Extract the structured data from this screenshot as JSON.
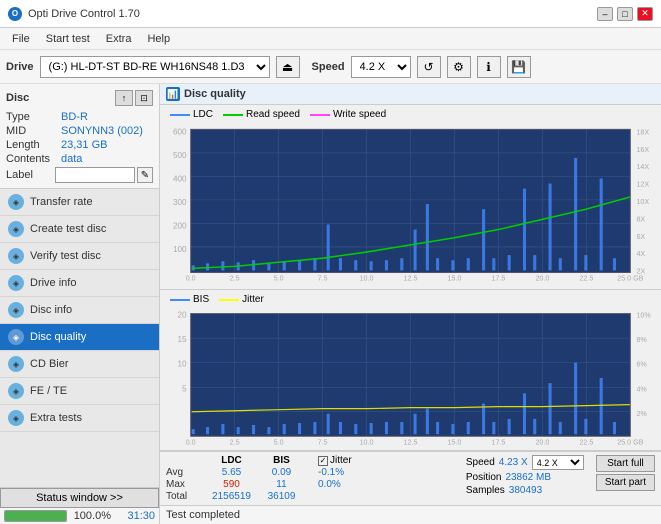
{
  "titlebar": {
    "title": "Opti Drive Control 1.70",
    "logo": "O",
    "min_btn": "–",
    "max_btn": "□",
    "close_btn": "✕"
  },
  "menubar": {
    "items": [
      "File",
      "Start test",
      "Extra",
      "Help"
    ]
  },
  "toolbar": {
    "drive_label": "Drive",
    "drive_value": "(G:) HL-DT-ST BD-RE  WH16NS48 1.D3",
    "speed_label": "Speed",
    "speed_value": "4.2 X"
  },
  "disc_panel": {
    "title": "Disc",
    "type_label": "Type",
    "type_value": "BD-R",
    "mid_label": "MID",
    "mid_value": "SONYNN3 (002)",
    "length_label": "Length",
    "length_value": "23,31 GB",
    "contents_label": "Contents",
    "contents_value": "data",
    "label_label": "Label",
    "label_value": ""
  },
  "nav_items": [
    {
      "id": "transfer-rate",
      "label": "Transfer rate",
      "active": false
    },
    {
      "id": "create-test-disc",
      "label": "Create test disc",
      "active": false
    },
    {
      "id": "verify-test-disc",
      "label": "Verify test disc",
      "active": false
    },
    {
      "id": "drive-info",
      "label": "Drive info",
      "active": false
    },
    {
      "id": "disc-info",
      "label": "Disc info",
      "active": false
    },
    {
      "id": "disc-quality",
      "label": "Disc quality",
      "active": true
    },
    {
      "id": "cd-bier",
      "label": "CD Bier",
      "active": false
    },
    {
      "id": "fe-te",
      "label": "FE / TE",
      "active": false
    },
    {
      "id": "extra-tests",
      "label": "Extra tests",
      "active": false
    }
  ],
  "quality_panel": {
    "title": "Disc quality",
    "legend1": {
      "ldc": "LDC",
      "read_speed": "Read speed",
      "write_speed": "Write speed"
    },
    "legend2": {
      "bis": "BIS",
      "jitter": "Jitter"
    },
    "y_axis1": [
      "600",
      "500",
      "400",
      "300",
      "200",
      "100"
    ],
    "y_axis1_right": [
      "18X",
      "16X",
      "14X",
      "12X",
      "10X",
      "8X",
      "6X",
      "4X",
      "2X"
    ],
    "x_axis": [
      "0.0",
      "2.5",
      "5.0",
      "7.5",
      "10.0",
      "12.5",
      "15.0",
      "17.5",
      "20.0",
      "22.5",
      "25.0 GB"
    ],
    "y_axis2": [
      "20",
      "15",
      "10",
      "5"
    ],
    "y_axis2_right": [
      "10%",
      "8%",
      "6%",
      "4%",
      "2%"
    ]
  },
  "stats": {
    "headers": [
      "",
      "LDC",
      "BIS",
      "",
      "Jitter",
      "Speed",
      "",
      ""
    ],
    "avg_label": "Avg",
    "avg_ldc": "5.65",
    "avg_bis": "0.09",
    "avg_jitter": "-0.1%",
    "max_label": "Max",
    "max_ldc": "590",
    "max_bis": "11",
    "max_jitter": "0.0%",
    "total_label": "Total",
    "total_ldc": "2156519",
    "total_bis": "36109",
    "speed_label": "Speed",
    "speed_value": "4.23 X",
    "speed_select": "4.2 X",
    "position_label": "Position",
    "position_value": "23862 MB",
    "samples_label": "Samples",
    "samples_value": "380493",
    "start_full_btn": "Start full",
    "start_part_btn": "Start part"
  },
  "status": {
    "text": "Test completed",
    "progress": 100,
    "progress_text": "100.0%",
    "time": "31:30"
  }
}
